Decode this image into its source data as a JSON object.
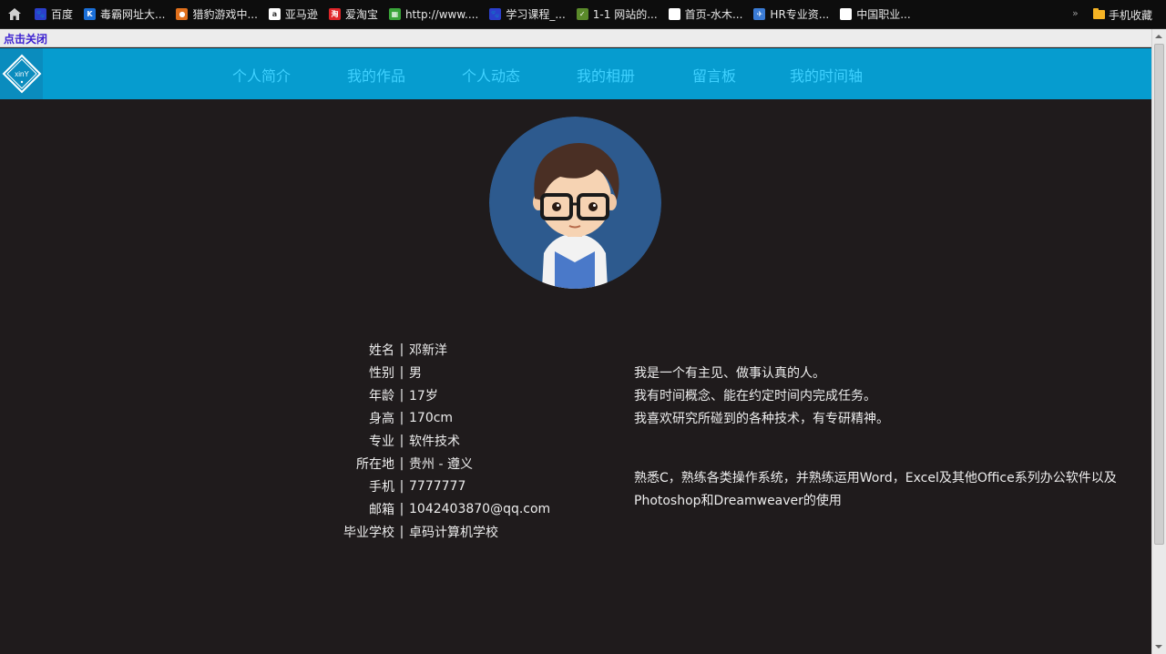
{
  "bookmarks": [
    {
      "label": "百度",
      "icon": "baidu-icon",
      "color": "#2b3fcc"
    },
    {
      "label": "毒霸网址大...",
      "icon": "duba-icon",
      "color": "#1a6fd8"
    },
    {
      "label": "猎豹游戏中...",
      "icon": "cheetah-game-icon",
      "color": "#e0701c"
    },
    {
      "label": "亚马逊",
      "icon": "amazon-icon",
      "color": "#ffffff"
    },
    {
      "label": "爱淘宝",
      "icon": "taobao-icon",
      "color": "#e0262a"
    },
    {
      "label": "http://www....",
      "icon": "grid-page-icon",
      "color": "#3aa53a"
    },
    {
      "label": "学习课程_...",
      "icon": "baidu-icon",
      "color": "#2b3fcc"
    },
    {
      "label": "1-1 网站的...",
      "icon": "course-icon",
      "color": "#5a8a2a"
    },
    {
      "label": "首页-水木...",
      "icon": "page-icon",
      "color": "#ffffff"
    },
    {
      "label": "HR专业资...",
      "icon": "bird-icon",
      "color": "#3a7bd5"
    },
    {
      "label": "中国职业...",
      "icon": "page-icon",
      "color": "#ffffff"
    }
  ],
  "bookmarks_more": "»",
  "bookmarks_folder": "手机收藏",
  "close_link": "点击关闭",
  "logo_text": "xinY",
  "nav": [
    {
      "label": "个人简介",
      "active": true
    },
    {
      "label": "我的作品",
      "active": false
    },
    {
      "label": "个人动态",
      "active": false
    },
    {
      "label": "我的相册",
      "active": false
    },
    {
      "label": "留言板",
      "active": false
    },
    {
      "label": "我的时间轴",
      "active": false
    }
  ],
  "profile": [
    {
      "label": "姓名",
      "value": "邓新洋"
    },
    {
      "label": "性别",
      "value": "男"
    },
    {
      "label": "年龄",
      "value": "17岁"
    },
    {
      "label": "身高",
      "value": "170cm"
    },
    {
      "label": "专业",
      "value": "软件技术"
    },
    {
      "label": "所在地",
      "value": "贵州 - 遵义"
    },
    {
      "label": "手机",
      "value": "7777777"
    },
    {
      "label": "邮箱",
      "value": "1042403870@qq.com"
    },
    {
      "label": "毕业学校",
      "value": "卓码计算机学校"
    }
  ],
  "separator": "|",
  "intro": [
    "我是一个有主见、做事认真的人。",
    "我有时间概念、能在约定时间内完成任务。",
    "我喜欢研究所碰到的各种技术，有专研精神。"
  ],
  "skills": [
    "熟悉C，熟练各类操作系统，并熟练运用Word，Excel及其他Office系列办公软件以及",
    "Photoshop和Dreamweaver的使用"
  ],
  "colors": {
    "nav_bg": "#069ccf",
    "nav_text": "#3fd1ff",
    "nav_active": "#ffffff",
    "page_bg": "#1f1b1c",
    "close_link": "#3a1fd0"
  }
}
